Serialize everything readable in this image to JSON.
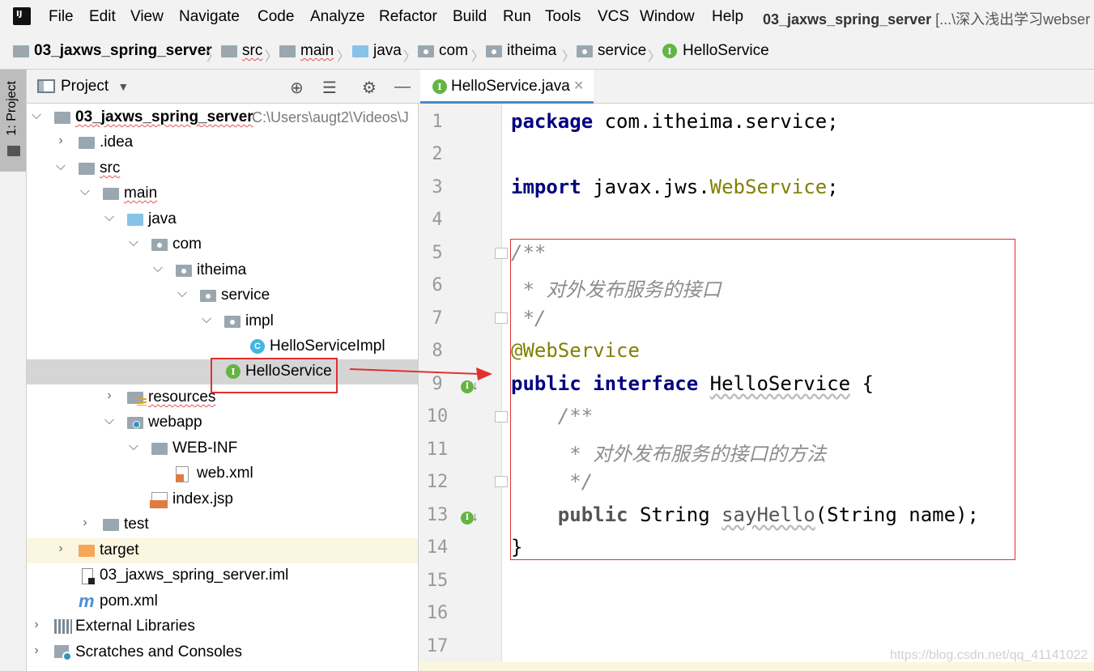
{
  "menubar": {
    "logo": "IJ",
    "items": [
      "File",
      "Edit",
      "View",
      "Navigate",
      "Code",
      "Analyze",
      "Refactor",
      "Build",
      "Run",
      "Tools",
      "VCS",
      "Window",
      "Help"
    ],
    "title_project": "03_jaxws_spring_server",
    "title_rest": " [...\\深入浅出学习webser"
  },
  "breadcrumb": [
    "03_jaxws_spring_server",
    "src",
    "main",
    "java",
    "com",
    "itheima",
    "service",
    "HelloService"
  ],
  "project_panel": {
    "title": "Project",
    "tree": [
      {
        "label": "03_jaxws_spring_server",
        "path": "C:\\Users\\augt2\\Videos\\J",
        "icon": "module-folder-icon"
      },
      {
        "label": ".idea",
        "icon": "folder-icon"
      },
      {
        "label": "src",
        "icon": "folder-icon"
      },
      {
        "label": "main",
        "icon": "folder-icon"
      },
      {
        "label": "java",
        "icon": "source-folder-icon"
      },
      {
        "label": "com",
        "icon": "package-icon"
      },
      {
        "label": "itheima",
        "icon": "package-icon"
      },
      {
        "label": "service",
        "icon": "package-icon"
      },
      {
        "label": "impl",
        "icon": "package-icon"
      },
      {
        "label": "HelloServiceImpl",
        "icon": "class-icon"
      },
      {
        "label": "HelloService",
        "icon": "interface-icon"
      },
      {
        "label": "resources",
        "icon": "resources-folder-icon"
      },
      {
        "label": "webapp",
        "icon": "web-folder-icon"
      },
      {
        "label": "WEB-INF",
        "icon": "folder-icon"
      },
      {
        "label": "web.xml",
        "icon": "xml-file-icon"
      },
      {
        "label": "index.jsp",
        "icon": "jsp-file-icon"
      },
      {
        "label": "test",
        "icon": "folder-icon"
      },
      {
        "label": "target",
        "icon": "excluded-folder-icon"
      },
      {
        "label": "03_jaxws_spring_server.iml",
        "icon": "iml-file-icon"
      },
      {
        "label": "pom.xml",
        "icon": "maven-icon"
      },
      {
        "label": "External Libraries",
        "icon": "libraries-icon"
      },
      {
        "label": "Scratches and Consoles",
        "icon": "scratches-icon"
      }
    ]
  },
  "sidebar_tab": "1: Project",
  "editor": {
    "tab_label": "HelloService.java",
    "line_numbers": [
      "1",
      "2",
      "3",
      "4",
      "5",
      "6",
      "7",
      "8",
      "9",
      "10",
      "11",
      "12",
      "13",
      "14",
      "15",
      "16",
      "17"
    ],
    "code": {
      "l1_kw": "package",
      "l1_rest": " com.itheima.service;",
      "l3_kw": "import",
      "l3_mid": " javax.jws.",
      "l3_anno": "WebService",
      "l3_end": ";",
      "l5": "/**",
      "l6": " * 对外发布服务的接口",
      "l7": " */",
      "l8": "@WebService",
      "l9_kw1": "public",
      "l9_kw2": "interface",
      "l9_name": "HelloService",
      "l9_end": " {",
      "l10": "    /**",
      "l11": "     * 对外发布服务的接口的方法",
      "l12": "     */",
      "l13_kw": "public",
      "l13_type": " String ",
      "l13_method": "sayHello",
      "l13_rest": "(String name);",
      "l14": "}"
    }
  },
  "watermark": "https://blog.csdn.net/qq_41141022"
}
